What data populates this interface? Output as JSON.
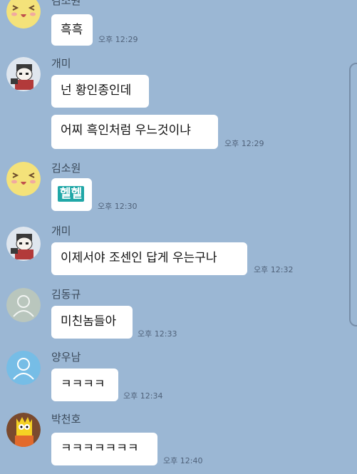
{
  "messages": [
    {
      "sender": "김소원",
      "text": "흑흑",
      "time": "오후 12:29"
    },
    {
      "sender": "개미",
      "text": "넌 황인종인데",
      "time": ""
    },
    {
      "sender": "",
      "text": "어찌 흑인처럼 우느것이냐",
      "time": "오후 12:29"
    },
    {
      "sender": "김소원",
      "text": "헬헬",
      "time": "오후 12:30"
    },
    {
      "sender": "개미",
      "text": "이제서야 조센인 답게 우는구나",
      "time": "오후 12:32"
    },
    {
      "sender": "김동규",
      "text": "미친놈들아",
      "time": "오후 12:33"
    },
    {
      "sender": "양우남",
      "text": "ㅋㅋㅋㅋ",
      "time": "오후 12:34"
    },
    {
      "sender": "박천호",
      "text": "ㅋㅋㅋㅋㅋㅋㅋ",
      "time": "오후 12:40"
    }
  ],
  "colors": {
    "background": "#9bb7d4",
    "bubble": "#ffffff",
    "emoticon": "#20a7a7"
  },
  "icons": [
    "laughing-face-avatar",
    "cartoon-character-avatar",
    "default-profile-avatar",
    "cartoon-character-avatar"
  ]
}
